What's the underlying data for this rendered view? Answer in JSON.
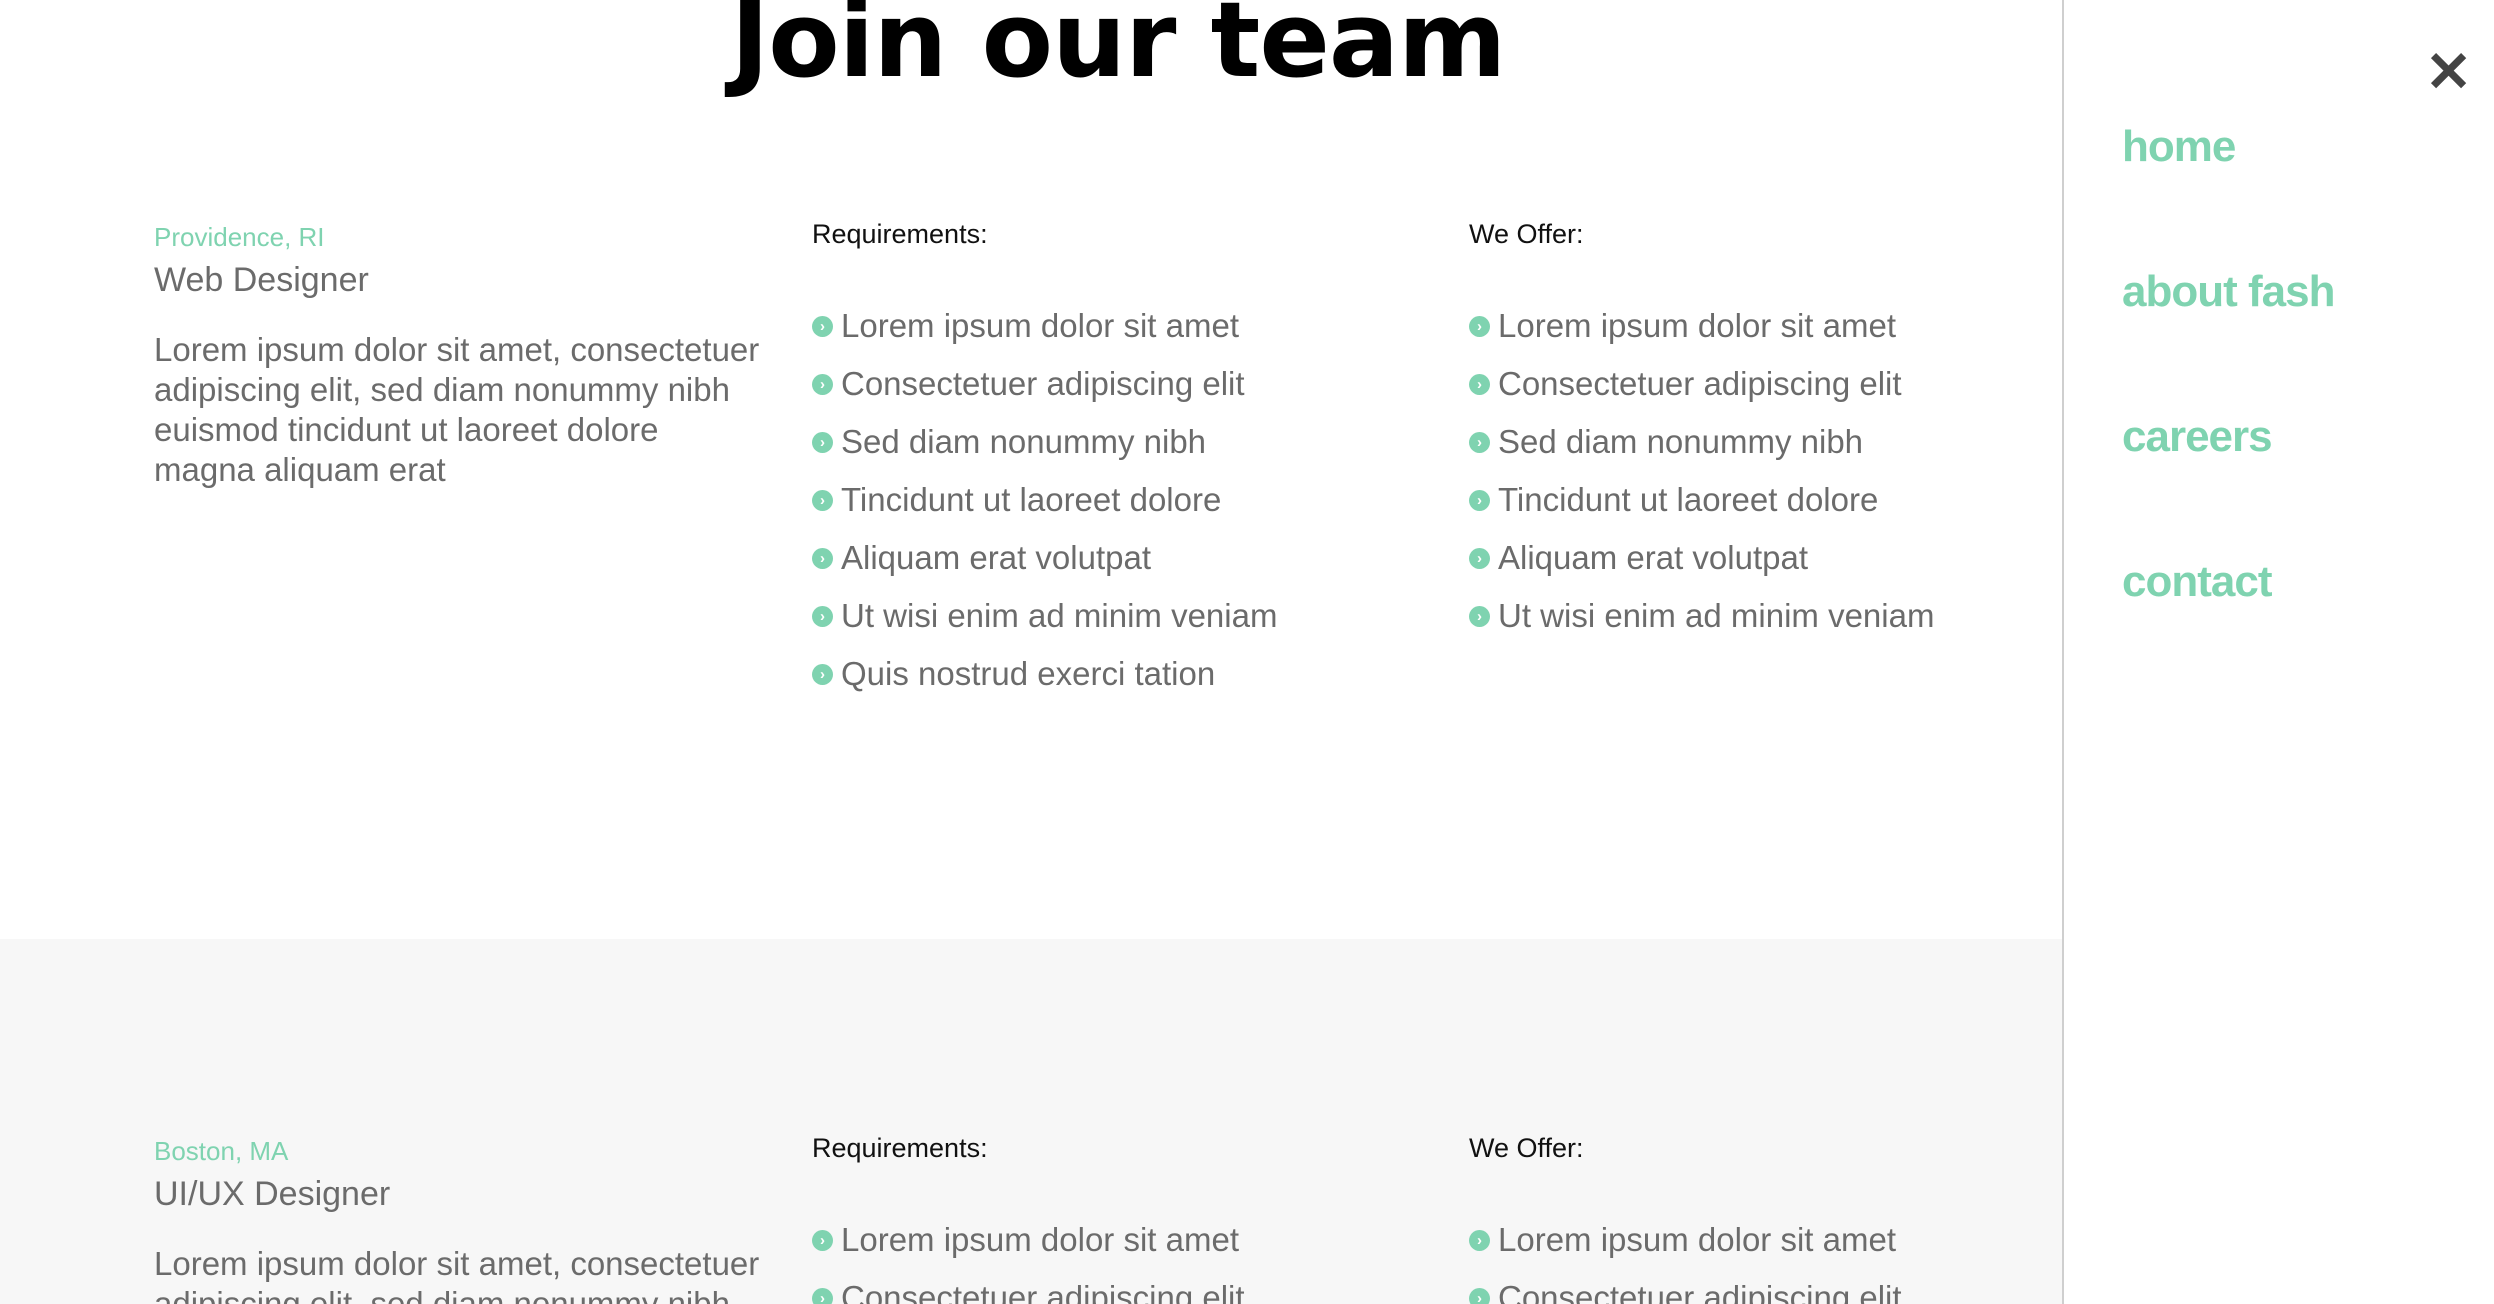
{
  "page_title": "Join our team",
  "jobs": [
    {
      "location": "Providence, RI",
      "role": "Web Designer",
      "description": "Lorem ipsum dolor sit amet, consectetuer adipiscing elit, sed diam nonummy nibh euismod tincidunt ut laoreet dolore magna aliquam erat",
      "requirements_heading": "Requirements:",
      "requirements": [
        "Lorem ipsum dolor sit amet",
        "Consectetuer adipiscing elit",
        "Sed diam nonummy nibh",
        "Tincidunt ut laoreet dolore",
        "Aliquam erat volutpat",
        "Ut wisi enim ad minim veniam",
        "Quis nostrud exerci tation"
      ],
      "offer_heading": "We Offer:",
      "offers": [
        "Lorem ipsum dolor sit amet",
        "Consectetuer adipiscing elit",
        "Sed diam nonummy nibh",
        "Tincidunt ut laoreet dolore",
        "Aliquam erat volutpat",
        "Ut wisi enim ad minim veniam"
      ]
    },
    {
      "location": "Boston, MA",
      "role": "UI/UX Designer",
      "description": "Lorem ipsum dolor sit amet, consectetuer adipiscing elit, sed diam nonummy nibh",
      "requirements_heading": "Requirements:",
      "requirements": [
        "Lorem ipsum dolor sit amet",
        "Consectetuer adipiscing elit"
      ],
      "offer_heading": "We Offer:",
      "offers": [
        "Lorem ipsum dolor sit amet",
        "Consectetuer adipiscing elit"
      ]
    }
  ],
  "nav": {
    "close_icon": "close-icon",
    "items": [
      "home",
      "about fash",
      "careers",
      "contact"
    ]
  },
  "colors": {
    "accent": "#7fd3b0",
    "section_alt_bg": "#f7f7f7",
    "text": "#6b6b6b",
    "heading": "#000000"
  }
}
